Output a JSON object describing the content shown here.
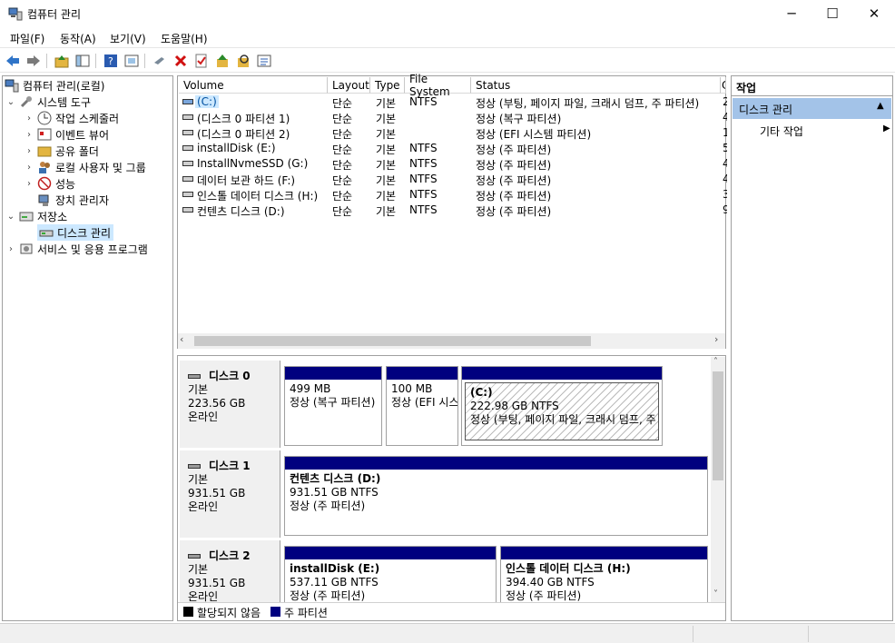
{
  "window": {
    "title": "컴퓨터 관리",
    "minimize": "─",
    "maximize": "☐",
    "close": "✕"
  },
  "menu": {
    "file": "파일(F)",
    "action": "동작(A)",
    "view": "보기(V)",
    "help": "도움말(H)"
  },
  "tree": {
    "root": "컴퓨터 관리(로컬)",
    "system_tools": "시스템 도구",
    "task_scheduler": "작업 스케줄러",
    "event_viewer": "이벤트 뷰어",
    "shared_folders": "공유 폴더",
    "local_users": "로컬 사용자 및 그룹",
    "performance": "성능",
    "device_manager": "장치 관리자",
    "storage": "저장소",
    "disk_management": "디스크 관리",
    "services": "서비스 및 응용 프로그램"
  },
  "volume_list": {
    "headers": {
      "volume": "Volume",
      "layout": "Layout",
      "type": "Type",
      "fs": "File System",
      "status": "Status",
      "extra": "C"
    },
    "rows": [
      {
        "volume": "(C:)",
        "layout": "단순",
        "type": "기본",
        "fs": "NTFS",
        "status": "정상 (부팅, 페이지 파일, 크래시 덤프, 주 파티션)",
        "extra": "2"
      },
      {
        "volume": "(디스크 0 파티션 1)",
        "layout": "단순",
        "type": "기본",
        "fs": "",
        "status": "정상 (복구 파티션)",
        "extra": "4"
      },
      {
        "volume": "(디스크 0 파티션 2)",
        "layout": "단순",
        "type": "기본",
        "fs": "",
        "status": "정상 (EFI 시스템 파티션)",
        "extra": "1"
      },
      {
        "volume": "installDisk (E:)",
        "layout": "단순",
        "type": "기본",
        "fs": "NTFS",
        "status": "정상 (주 파티션)",
        "extra": "5"
      },
      {
        "volume": "InstallNvmeSSD (G:)",
        "layout": "단순",
        "type": "기본",
        "fs": "NTFS",
        "status": "정상 (주 파티션)",
        "extra": "4"
      },
      {
        "volume": "데이터 보관 하드 (F:)",
        "layout": "단순",
        "type": "기본",
        "fs": "NTFS",
        "status": "정상 (주 파티션)",
        "extra": "4"
      },
      {
        "volume": "인스톨 데이터 디스크 (H:)",
        "layout": "단순",
        "type": "기본",
        "fs": "NTFS",
        "status": "정상 (주 파티션)",
        "extra": "3"
      },
      {
        "volume": "컨텐츠 디스크 (D:)",
        "layout": "단순",
        "type": "기본",
        "fs": "NTFS",
        "status": "정상 (주 파티션)",
        "extra": "9"
      }
    ]
  },
  "disks": [
    {
      "name": "디스크 0",
      "type": "기본",
      "size": "223.56 GB",
      "state": "온라인",
      "partitions": [
        {
          "title": "",
          "size": "499 MB",
          "status": "정상 (복구 파티션)"
        },
        {
          "title": "",
          "size": "100 MB",
          "status": "정상 (EFI 시스템 파티션)"
        },
        {
          "title": "(C:)",
          "size": "222.98 GB NTFS",
          "status": "정상 (부팅, 페이지 파일, 크래시 덤프, 주 파티션)"
        }
      ]
    },
    {
      "name": "디스크 1",
      "type": "기본",
      "size": "931.51 GB",
      "state": "온라인",
      "partitions": [
        {
          "title": "컨텐츠 디스크  (D:)",
          "size": "931.51 GB NTFS",
          "status": "정상 (주 파티션)"
        }
      ]
    },
    {
      "name": "디스크 2",
      "type": "기본",
      "size": "931.51 GB",
      "state": "온라인",
      "partitions": [
        {
          "title": "installDisk  (E:)",
          "size": "537.11 GB NTFS",
          "status": "정상 (주 파티션)"
        },
        {
          "title": "인스톨 데이터 디스크  (H:)",
          "size": "394.40 GB NTFS",
          "status": "정상 (주 파티션)"
        }
      ]
    }
  ],
  "legend": {
    "unallocated": "할당되지 않음",
    "primary": "주 파티션"
  },
  "actions": {
    "header": "작업",
    "section": "디스크 관리",
    "more": "기타 작업"
  },
  "colors": {
    "partition_bar": "#00007f",
    "selection": "#cce8ff",
    "action_section": "#a3c3e8",
    "unallocated": "#000000"
  }
}
